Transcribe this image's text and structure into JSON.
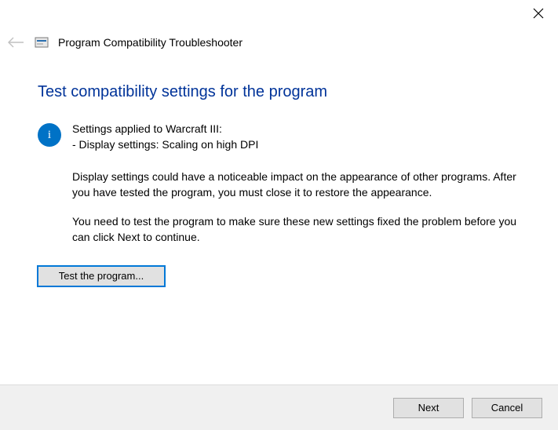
{
  "header": {
    "window_title": "Program Compatibility Troubleshooter"
  },
  "content": {
    "page_title": "Test compatibility settings for the program",
    "settings_applied_line1": "Settings applied to Warcraft III:",
    "settings_applied_line2": "- Display settings:  Scaling on high DPI",
    "body_para1": "Display settings could have a noticeable impact on the appearance of other programs. After you have tested the program, you must close it to restore the appearance.",
    "body_para2": "You need to test the program to make sure these new settings fixed the problem before you can click Next to continue.",
    "test_button_label": "Test the program..."
  },
  "footer": {
    "next_label": "Next",
    "cancel_label": "Cancel"
  }
}
